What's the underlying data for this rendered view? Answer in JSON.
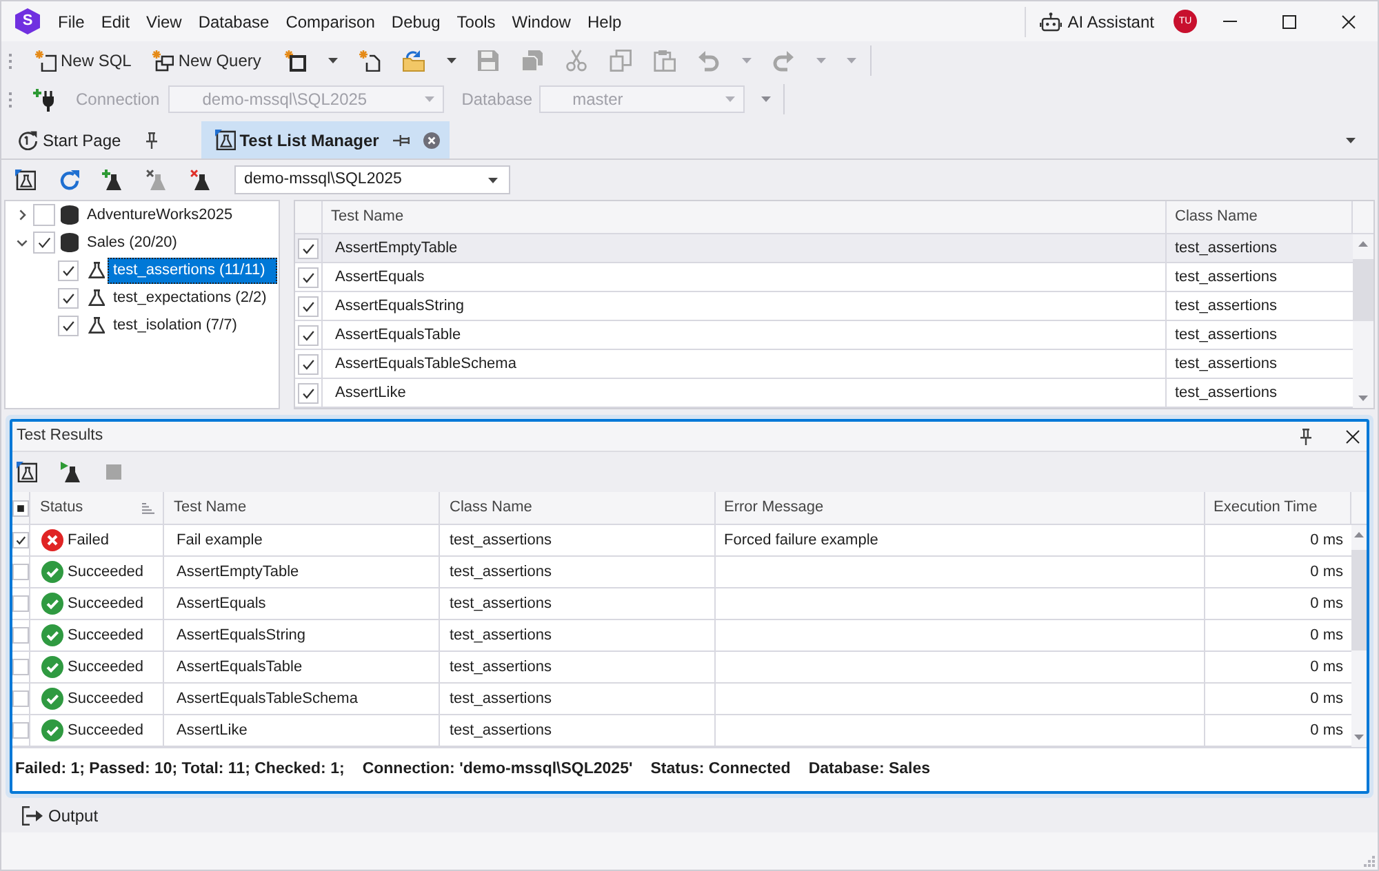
{
  "menu_bar": {
    "logo": "S",
    "items": [
      "File",
      "Edit",
      "View",
      "Database",
      "Comparison",
      "Debug",
      "Tools",
      "Window",
      "Help"
    ],
    "ai_assistant": "AI Assistant",
    "avatar": "TU"
  },
  "toolbar": {
    "buttons": [
      {
        "kind": "labeled",
        "label": "New SQL",
        "disabled": false
      },
      {
        "kind": "labeled",
        "label": "New Query",
        "disabled": false
      },
      {
        "kind": "icon",
        "disabled": false
      },
      {
        "kind": "dropdown",
        "disabled": false
      },
      {
        "kind": "icon",
        "disabled": false
      },
      {
        "kind": "icon",
        "disabled": false
      },
      {
        "kind": "dropdown",
        "disabled": false
      },
      {
        "kind": "icon",
        "disabled": true
      },
      {
        "kind": "icon",
        "disabled": true
      },
      {
        "kind": "icon",
        "disabled": true
      },
      {
        "kind": "icon",
        "disabled": true
      },
      {
        "kind": "icon",
        "disabled": true
      },
      {
        "kind": "icon",
        "disabled": true
      },
      {
        "kind": "dropdown",
        "disabled": true
      },
      {
        "kind": "icon",
        "disabled": true
      },
      {
        "kind": "dropdown",
        "disabled": true
      },
      {
        "kind": "dropdown",
        "disabled": true
      }
    ]
  },
  "connection_bar": {
    "connection_label": "Connection",
    "connection": "demo-mssql\\SQL2025",
    "database_label": "Database",
    "database": "master",
    "disabled": true
  },
  "tabs": [
    {
      "label": "Start Page",
      "selected": false
    },
    {
      "label": "Test List Manager",
      "selected": true
    }
  ],
  "test_list_manager": {
    "toolbar": [
      {
        "disabled": false
      },
      {
        "disabled": false
      },
      {
        "disabled": false
      },
      {
        "disabled": true
      },
      {
        "disabled": false
      }
    ],
    "connection": "demo-mssql\\SQL2025",
    "tree": [
      {
        "label": "AdventureWorks2025",
        "expanded": false,
        "checked": false,
        "selected": false
      },
      {
        "label": "Sales (20/20)",
        "expanded": true,
        "checked": true,
        "selected": false,
        "children": [
          {
            "label": "test_assertions (11/11)",
            "checked": true,
            "selected": true
          },
          {
            "label": "test_expectations (2/2)",
            "checked": true,
            "selected": false
          },
          {
            "label": "test_isolation (7/7)",
            "checked": true,
            "selected": false
          }
        ]
      }
    ],
    "grid": {
      "columns": [
        "Test Name",
        "Class Name"
      ],
      "rows": [
        {
          "checked": true,
          "selected": true,
          "test_name": "AssertEmptyTable",
          "class_name": "test_assertions"
        },
        {
          "checked": true,
          "selected": false,
          "test_name": "AssertEquals",
          "class_name": "test_assertions"
        },
        {
          "checked": true,
          "selected": false,
          "test_name": "AssertEqualsString",
          "class_name": "test_assertions"
        },
        {
          "checked": true,
          "selected": false,
          "test_name": "AssertEqualsTable",
          "class_name": "test_assertions"
        },
        {
          "checked": true,
          "selected": false,
          "test_name": "AssertEqualsTableSchema",
          "class_name": "test_assertions"
        },
        {
          "checked": true,
          "selected": false,
          "test_name": "AssertLike",
          "class_name": "test_assertions"
        }
      ]
    }
  },
  "test_results": {
    "title": "Test Results",
    "toolbar": [
      {
        "disabled": false
      },
      {
        "disabled": false
      },
      {
        "disabled": true
      }
    ],
    "header_checkbox": {
      "checked": false,
      "partial": true
    },
    "columns": [
      {
        "label": "Status",
        "sorted": true
      },
      {
        "label": "Test Name",
        "sorted": false
      },
      {
        "label": "Class Name",
        "sorted": false
      },
      {
        "label": "Error Message",
        "sorted": false
      },
      {
        "label": "Execution Time",
        "sorted": false
      }
    ],
    "rows": [
      {
        "checked": true,
        "kind": "failed",
        "status": "Failed",
        "test_name": "Fail example",
        "class_name": "test_assertions",
        "error_message": "Forced failure example",
        "execution_time": "0 ms"
      },
      {
        "checked": false,
        "kind": "succeeded",
        "status": "Succeeded",
        "test_name": "AssertEmptyTable",
        "class_name": "test_assertions",
        "execution_time": "0 ms"
      },
      {
        "checked": false,
        "kind": "succeeded",
        "status": "Succeeded",
        "test_name": "AssertEquals",
        "class_name": "test_assertions",
        "execution_time": "0 ms"
      },
      {
        "checked": false,
        "kind": "succeeded",
        "status": "Succeeded",
        "test_name": "AssertEqualsString",
        "class_name": "test_assertions",
        "execution_time": "0 ms"
      },
      {
        "checked": false,
        "kind": "succeeded",
        "status": "Succeeded",
        "test_name": "AssertEqualsTable",
        "class_name": "test_assertions",
        "execution_time": "0 ms"
      },
      {
        "checked": false,
        "kind": "succeeded",
        "status": "Succeeded",
        "test_name": "AssertEqualsTableSchema",
        "class_name": "test_assertions",
        "execution_time": "0 ms"
      },
      {
        "checked": false,
        "kind": "succeeded",
        "status": "Succeeded",
        "test_name": "AssertLike",
        "class_name": "test_assertions",
        "execution_time": "0 ms"
      }
    ],
    "summary": [
      "Failed: 1; Passed: 10; Total: 11; Checked: 1;",
      "Connection: 'demo-mssql\\SQL2025'",
      "Status: Connected",
      "Database: Sales"
    ]
  },
  "output_tab": "Output"
}
